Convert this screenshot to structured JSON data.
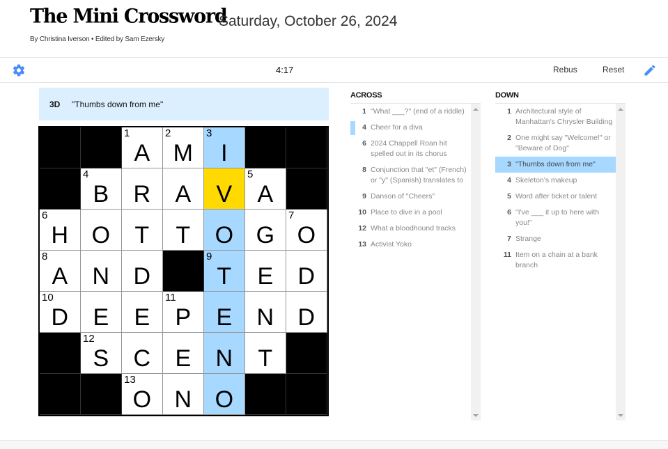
{
  "header": {
    "title": "The Mini Crossword",
    "date": "Saturday, October 26, 2024",
    "byline": "By Christina Iverson  •  Edited by Sam Ezersky"
  },
  "toolbar": {
    "settings_icon": "gear-icon",
    "timer": "4:17",
    "rebus_label": "Rebus",
    "reset_label": "Reset",
    "pencil_icon": "pencil-icon"
  },
  "colors": {
    "accent": "#4a8df6",
    "highlight_word": "#a7d8ff",
    "active_cell": "#ffda00",
    "clue_bar": "#dcefff"
  },
  "clue_bar": {
    "number": "3D",
    "text": "\"Thumbs down from me\""
  },
  "grid": {
    "rows": [
      [
        {
          "b": 1
        },
        {
          "b": 1
        },
        {
          "n": "1",
          "l": "A"
        },
        {
          "n": "2",
          "l": "M"
        },
        {
          "n": "3",
          "l": "I",
          "h": "word"
        },
        {
          "b": 1
        },
        {
          "b": 1
        }
      ],
      [
        {
          "b": 1
        },
        {
          "n": "4",
          "l": "B"
        },
        {
          "l": "R"
        },
        {
          "l": "A"
        },
        {
          "l": "V",
          "h": "active"
        },
        {
          "n": "5",
          "l": "A"
        },
        {
          "b": 1
        }
      ],
      [
        {
          "n": "6",
          "l": "H"
        },
        {
          "l": "O"
        },
        {
          "l": "T"
        },
        {
          "l": "T"
        },
        {
          "l": "O",
          "h": "word"
        },
        {
          "l": "G"
        },
        {
          "n": "7",
          "l": "O"
        }
      ],
      [
        {
          "n": "8",
          "l": "A"
        },
        {
          "l": "N"
        },
        {
          "l": "D"
        },
        {
          "b": 1
        },
        {
          "n": "9",
          "l": "T",
          "h": "word"
        },
        {
          "l": "E"
        },
        {
          "l": "D"
        }
      ],
      [
        {
          "n": "10",
          "l": "D"
        },
        {
          "l": "E"
        },
        {
          "l": "E"
        },
        {
          "n": "11",
          "l": "P"
        },
        {
          "l": "E",
          "h": "word"
        },
        {
          "l": "N"
        },
        {
          "l": "D"
        }
      ],
      [
        {
          "b": 1
        },
        {
          "n": "12",
          "l": "S"
        },
        {
          "l": "C"
        },
        {
          "l": "E"
        },
        {
          "l": "N",
          "h": "word"
        },
        {
          "l": "T"
        },
        {
          "b": 1
        }
      ],
      [
        {
          "b": 1
        },
        {
          "b": 1
        },
        {
          "n": "13",
          "l": "O"
        },
        {
          "l": "N"
        },
        {
          "l": "O",
          "h": "word"
        },
        {
          "b": 1
        },
        {
          "b": 1
        }
      ]
    ]
  },
  "across": {
    "title": "ACROSS",
    "clues": [
      {
        "num": "1",
        "text": "\"What ___?\" (end of a riddle)"
      },
      {
        "num": "4",
        "text": "Cheer for a diva",
        "state": "cross-ref"
      },
      {
        "num": "6",
        "text": "2024 Chappell Roan hit spelled out in its chorus"
      },
      {
        "num": "8",
        "text": "Conjunction that \"et\" (French) or \"y\" (Spanish) translates to"
      },
      {
        "num": "9",
        "text": "Danson of \"Cheers\""
      },
      {
        "num": "10",
        "text": "Place to dive in a pool"
      },
      {
        "num": "12",
        "text": "What a bloodhound tracks"
      },
      {
        "num": "13",
        "text": "Activist Yoko"
      }
    ]
  },
  "down": {
    "title": "DOWN",
    "clues": [
      {
        "num": "1",
        "text": "Architectural style of Manhattan's Chrysler Building"
      },
      {
        "num": "2",
        "text": "One might say \"Welcome!\" or \"Beware of Dog\""
      },
      {
        "num": "3",
        "text": "\"Thumbs down from me\"",
        "state": "current"
      },
      {
        "num": "4",
        "text": "Skeleton's makeup"
      },
      {
        "num": "5",
        "text": "Word after ticket or talent"
      },
      {
        "num": "6",
        "text": "\"I've ___ it up to here with you!\""
      },
      {
        "num": "7",
        "text": "Strange"
      },
      {
        "num": "11",
        "text": "Item on a chain at a bank branch"
      }
    ]
  }
}
